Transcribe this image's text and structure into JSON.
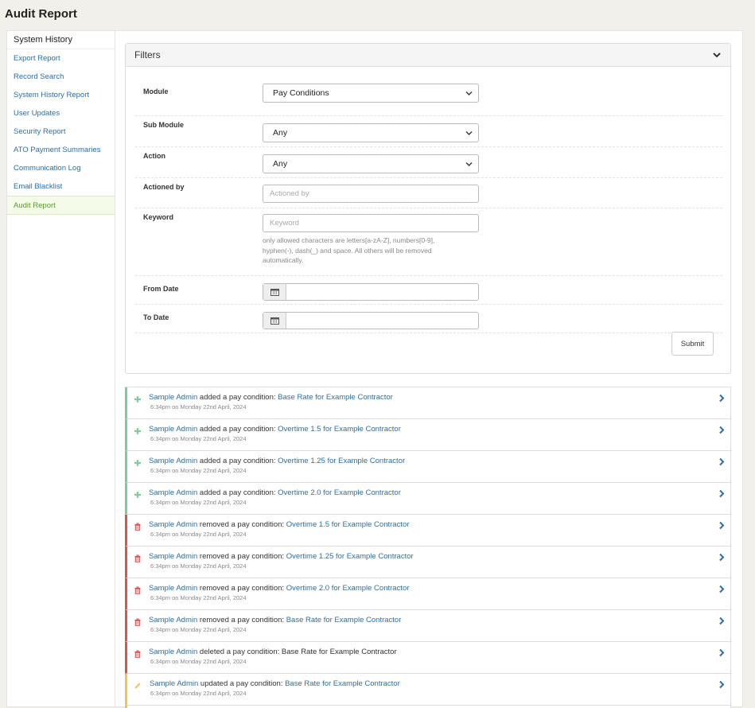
{
  "page": {
    "title": "Audit Report"
  },
  "sidebar": {
    "header": "System History",
    "items": [
      {
        "label": "Export Report"
      },
      {
        "label": "Record Search"
      },
      {
        "label": "System History Report"
      },
      {
        "label": "User Updates"
      },
      {
        "label": "Security Report"
      },
      {
        "label": "ATO Payment Summaries"
      },
      {
        "label": "Communication Log"
      },
      {
        "label": "Email Blacklist"
      },
      {
        "label": "Audit Report",
        "active": true
      }
    ]
  },
  "filters": {
    "title": "Filters",
    "module": {
      "label": "Module",
      "value": "Pay Conditions"
    },
    "sub_module": {
      "label": "Sub Module",
      "value": "Any"
    },
    "action": {
      "label": "Action",
      "value": "Any"
    },
    "actioned_by": {
      "label": "Actioned by",
      "placeholder": "Actioned by"
    },
    "keyword": {
      "label": "Keyword",
      "placeholder": "Keyword",
      "hint": "only allowed characters are letters[a-zA-Z], numbers[0-9], hyphen(-), dash(_) and space. All others will be removed automatically."
    },
    "from_date": {
      "label": "From Date",
      "value": ""
    },
    "to_date": {
      "label": "To Date",
      "value": ""
    },
    "submit_label": "Submit"
  },
  "colors": {
    "add": "#7fcb9a",
    "remove": "#d9534f",
    "update": "#f0c25a",
    "link": "#2a6fa8"
  },
  "log": [
    {
      "type": "add",
      "icon": "plus-icon",
      "user": "Sample Admin",
      "action": " added a pay condition: ",
      "object": "Base Rate for Example Contractor",
      "object_link": true,
      "time": "6:34pm on Monday 22nd April, 2024"
    },
    {
      "type": "add",
      "icon": "plus-icon",
      "user": "Sample Admin",
      "action": " added a pay condition: ",
      "object": "Overtime 1.5 for Example Contractor",
      "object_link": true,
      "time": "6:34pm on Monday 22nd April, 2024"
    },
    {
      "type": "add",
      "icon": "plus-icon",
      "user": "Sample Admin",
      "action": " added a pay condition: ",
      "object": "Overtime 1.25 for Example Contractor",
      "object_link": true,
      "time": "6:34pm on Monday 22nd April, 2024"
    },
    {
      "type": "add",
      "icon": "plus-icon",
      "user": "Sample Admin",
      "action": " added a pay condition: ",
      "object": "Overtime 2.0 for Example Contractor",
      "object_link": true,
      "time": "6:34pm on Monday 22nd April, 2024"
    },
    {
      "type": "remove",
      "icon": "trash-icon",
      "user": "Sample Admin",
      "action": " removed a pay condition: ",
      "object": "Overtime 1.5 for Example Contractor",
      "object_link": true,
      "time": "6:34pm on Monday 22nd April, 2024"
    },
    {
      "type": "remove",
      "icon": "trash-icon",
      "user": "Sample Admin",
      "action": " removed a pay condition: ",
      "object": "Overtime 1.25 for Example Contractor",
      "object_link": true,
      "time": "6:34pm on Monday 22nd April, 2024"
    },
    {
      "type": "remove",
      "icon": "trash-icon",
      "user": "Sample Admin",
      "action": " removed a pay condition: ",
      "object": "Overtime 2.0 for Example Contractor",
      "object_link": true,
      "time": "6:34pm on Monday 22nd April, 2024"
    },
    {
      "type": "remove",
      "icon": "trash-icon",
      "user": "Sample Admin",
      "action": " removed a pay condition: ",
      "object": "Base Rate for Example Contractor",
      "object_link": true,
      "time": "6:34pm on Monday 22nd April, 2024"
    },
    {
      "type": "remove",
      "icon": "trash-icon",
      "user": "Sample Admin",
      "action": " deleted a pay condition: ",
      "object": "Base Rate for Example Contractor",
      "object_link": false,
      "time": "6:34pm on Monday 22nd April, 2024"
    },
    {
      "type": "update",
      "icon": "pencil-icon",
      "user": "Sample Admin",
      "action": " updated a pay condition: ",
      "object": "Base Rate for Example Contractor",
      "object_link": true,
      "time": "6:34pm on Monday 22nd April, 2024"
    },
    {
      "type": "update",
      "icon": "pencil-icon",
      "user": "",
      "action": "",
      "object": "",
      "object_link": false,
      "time": ""
    }
  ]
}
